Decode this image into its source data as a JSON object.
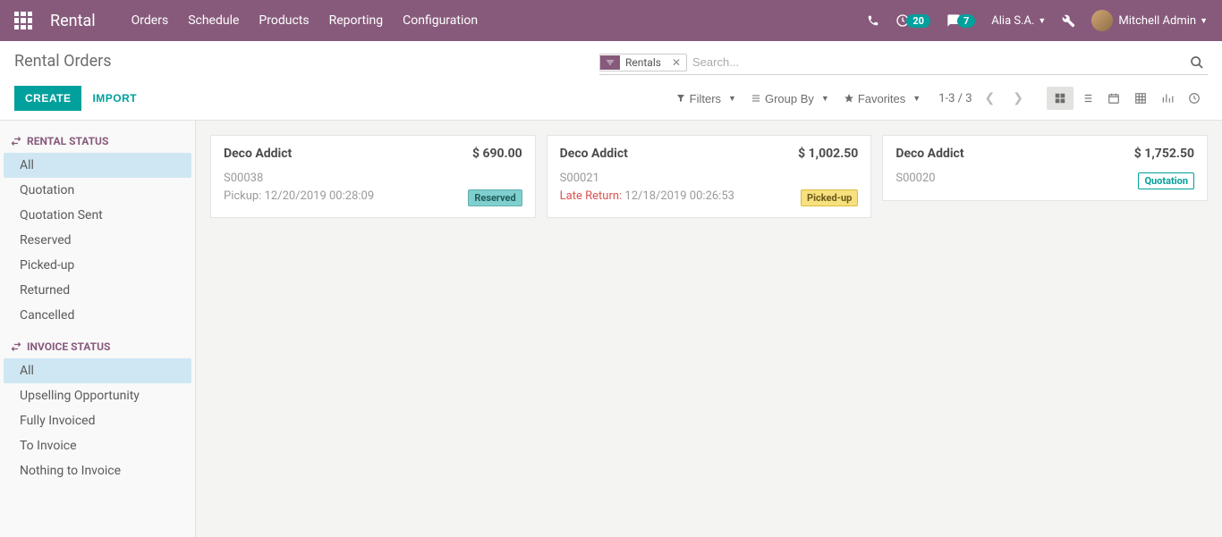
{
  "navbar": {
    "brand": "Rental",
    "menu": [
      "Orders",
      "Schedule",
      "Products",
      "Reporting",
      "Configuration"
    ],
    "activity_count": "20",
    "message_count": "7",
    "switch_user": "Alia S.A.",
    "user": "Mitchell Admin"
  },
  "page": {
    "title": "Rental Orders",
    "search_facet": "Rentals",
    "search_placeholder": "Search...",
    "create_label": "CREATE",
    "import_label": "IMPORT",
    "filters_label": "Filters",
    "groupby_label": "Group By",
    "favorites_label": "Favorites",
    "pager": "1-3 / 3"
  },
  "sidebar": {
    "rental_status": {
      "title": "RENTAL STATUS",
      "items": [
        "All",
        "Quotation",
        "Quotation Sent",
        "Reserved",
        "Picked-up",
        "Returned",
        "Cancelled"
      ],
      "active_index": 0
    },
    "invoice_status": {
      "title": "INVOICE STATUS",
      "items": [
        "All",
        "Upselling Opportunity",
        "Fully Invoiced",
        "To Invoice",
        "Nothing to Invoice"
      ],
      "active_index": 0
    }
  },
  "cards": [
    {
      "customer": "Deco Addict",
      "amount": "$ 690.00",
      "ref": "S00038",
      "line2_label": "Pickup: ",
      "line2_value": "12/20/2019 00:28:09",
      "line2_late": false,
      "tag": "Reserved",
      "tag_class": "tag-reserved"
    },
    {
      "customer": "Deco Addict",
      "amount": "$ 1,002.50",
      "ref": "S00021",
      "line2_label": "Late Return: ",
      "line2_value": "12/18/2019 00:26:53",
      "line2_late": true,
      "tag": "Picked-up",
      "tag_class": "tag-pickedup"
    },
    {
      "customer": "Deco Addict",
      "amount": "$ 1,752.50",
      "ref": "S00020",
      "line2_label": "",
      "line2_value": "",
      "line2_late": false,
      "tag": "Quotation",
      "tag_class": "tag-quotation"
    }
  ]
}
